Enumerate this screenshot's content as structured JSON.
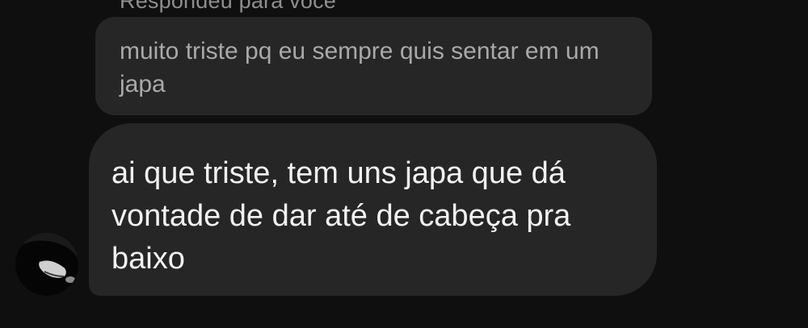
{
  "thread": {
    "reply_header": "Respondeu para você",
    "quoted_message": "muito triste pq eu sempre quis sentar em um japa",
    "message": "ai que triste, tem uns japa que dá vontade de dar até de cabeça pra baixo"
  },
  "avatar": {
    "icon": "profile-photo",
    "colors": {
      "background": "#1a1a1a",
      "hair": "#050505",
      "skin": "#cfcfcf"
    }
  },
  "colors": {
    "background": "#0f0f0f",
    "bubble": "#262626",
    "quoted_text": "#a9a9a9",
    "message_text": "#f2f2f2",
    "header_text": "#8e8e8e"
  }
}
